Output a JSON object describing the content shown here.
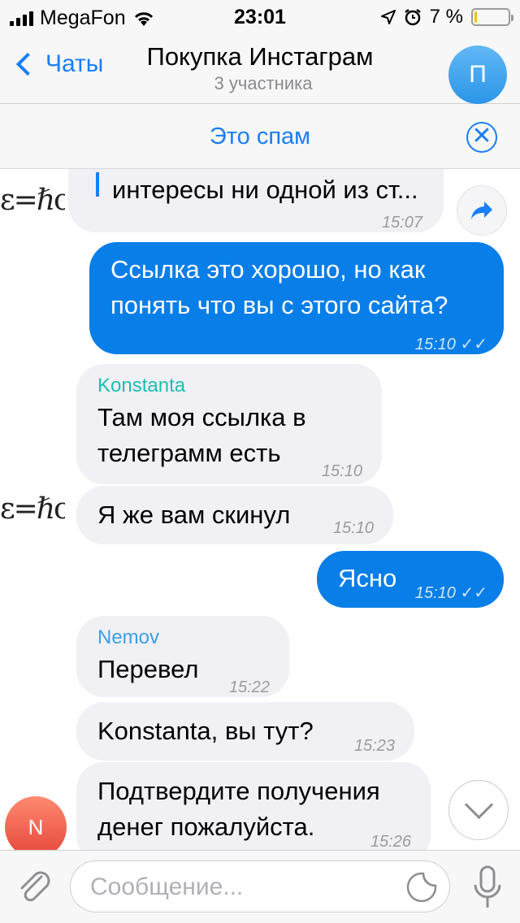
{
  "status_bar": {
    "carrier": "MegaFon",
    "time": "23:01",
    "battery": "7 %",
    "battery_level": 0.07
  },
  "header": {
    "back_label": "Чаты",
    "title": "Покупка Инстаграм",
    "subtitle": "3 участника",
    "avatar_letter": "П"
  },
  "spam_bar": {
    "label": "Это спам",
    "close_glyph": "✕"
  },
  "messages": [
    {
      "id": "m0",
      "direction": "in",
      "text": "интересы ни одной из ст...",
      "time": "15:07"
    },
    {
      "id": "m1",
      "direction": "out",
      "text": "Ссылка это хорошо, но как понять что вы с этого сайта?",
      "time": "15:10",
      "ticks": "✓✓"
    },
    {
      "id": "m2",
      "direction": "in",
      "sender": "Konstanta",
      "text": "Там моя ссылка в телеграмм есть",
      "time": "15:10"
    },
    {
      "id": "m3",
      "direction": "in",
      "text": "Я же вам скинул",
      "time": "15:10"
    },
    {
      "id": "m4",
      "direction": "out",
      "text": "Ясно",
      "time": "15:10",
      "ticks": "✓✓"
    },
    {
      "id": "m5",
      "direction": "in",
      "sender": "Nemov",
      "text": "Перевел",
      "time": "15:22"
    },
    {
      "id": "m6",
      "direction": "in",
      "text": "Konstanta, вы тут?",
      "time": "15:23"
    },
    {
      "id": "m7",
      "direction": "in",
      "text": "Подтвердите получения денег пожалуйста.",
      "time": "15:26"
    }
  ],
  "sticker_text": "ε=ℏc",
  "avatar_n_letter": "N",
  "input": {
    "placeholder": "Сообщение..."
  },
  "colors": {
    "accent": "#1a7ef7",
    "outgoing_bubble": "#087ee8",
    "incoming_bubble": "#f0f0f5",
    "sender_konstanta": "#1bbfb0",
    "sender_nemov": "#3b9fe8"
  }
}
